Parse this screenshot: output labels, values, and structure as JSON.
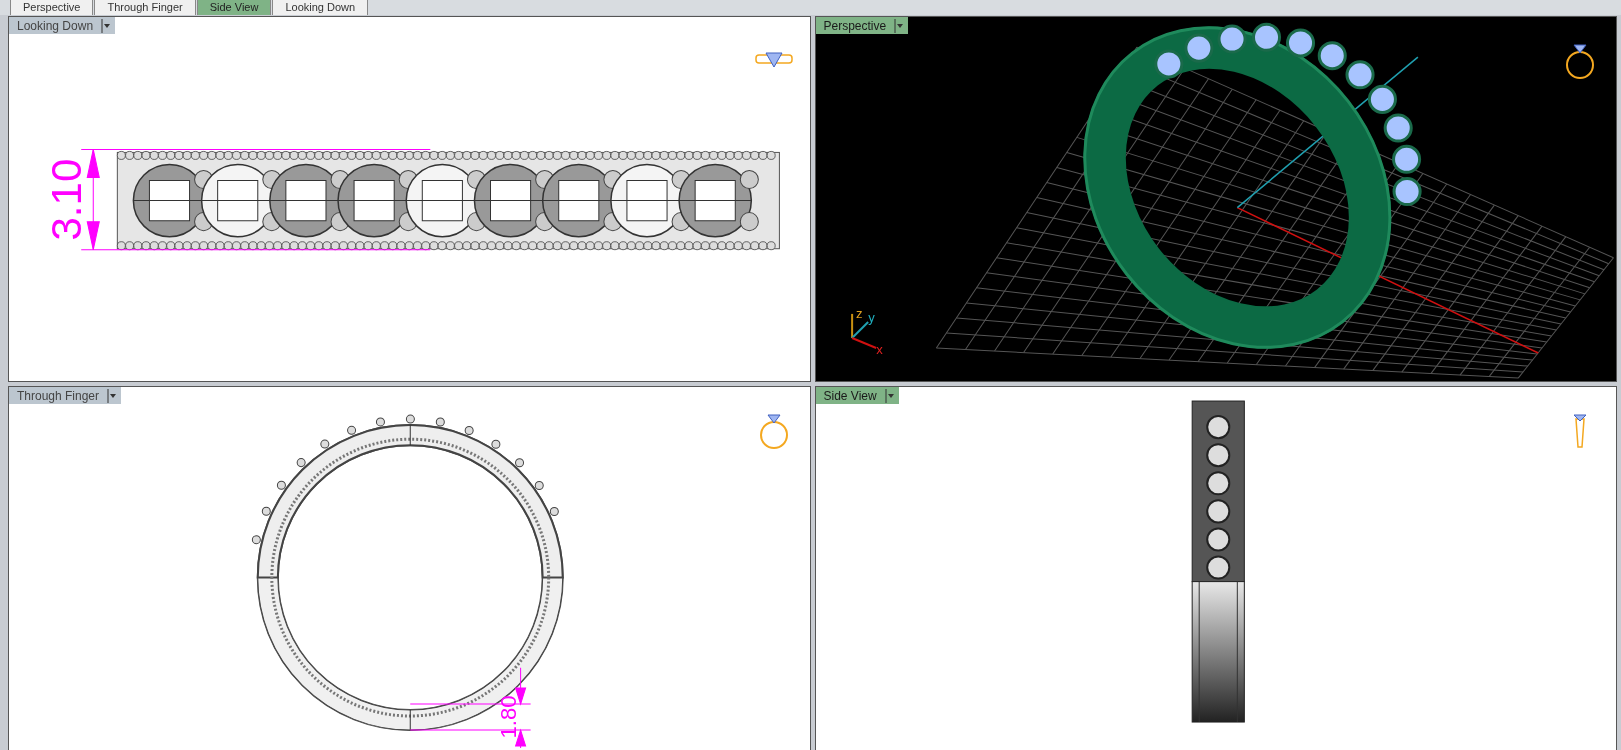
{
  "tabs": [
    {
      "label": "Perspective",
      "selected": false
    },
    {
      "label": "Through Finger",
      "selected": false
    },
    {
      "label": "Side View",
      "selected": true
    },
    {
      "label": "Looking Down",
      "selected": false
    }
  ],
  "viewports": [
    {
      "label": "Looking Down",
      "active": false,
      "kind": "top",
      "dimension": "3.10"
    },
    {
      "label": "Perspective",
      "active": true,
      "kind": "perspective",
      "axes": [
        "z",
        "y",
        "x"
      ]
    },
    {
      "label": "Through Finger",
      "active": false,
      "kind": "front",
      "dimension": "1.80"
    },
    {
      "label": "Side View",
      "active": true,
      "kind": "side"
    }
  ]
}
